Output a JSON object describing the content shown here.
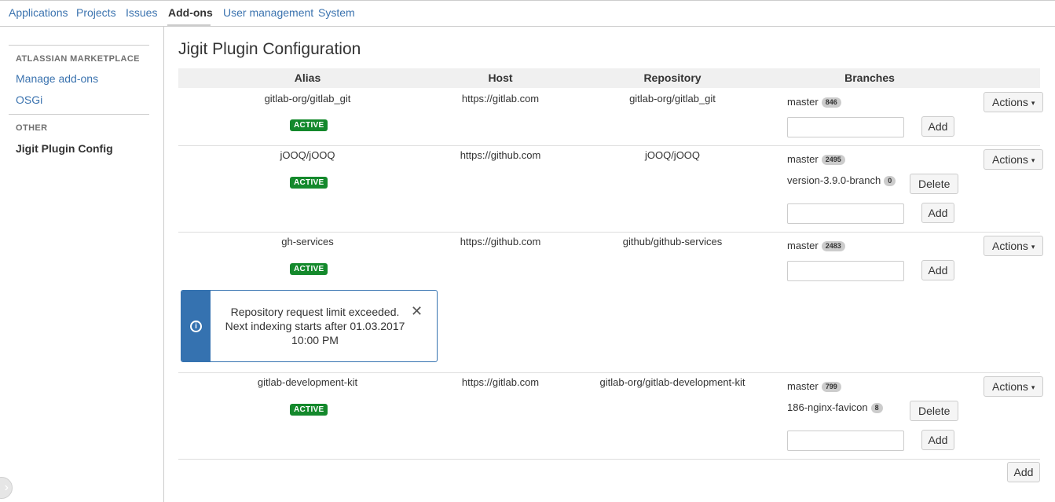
{
  "topnav": {
    "items": [
      "Applications",
      "Projects",
      "Issues",
      "Add-ons",
      "User management",
      "System"
    ],
    "active": "Add-ons"
  },
  "sidebar": {
    "section1": "ATLASSIAN MARKETPLACE",
    "link1": "Manage add-ons",
    "link2": "OSGi",
    "section2": "OTHER",
    "current": "Jigit Plugin Config"
  },
  "page": {
    "title": "Jigit Plugin Configuration"
  },
  "table": {
    "headers": {
      "alias": "Alias",
      "host": "Host",
      "repository": "Repository",
      "branches": "Branches"
    },
    "rows": [
      {
        "alias": "gitlab-org/gitlab_git",
        "host": "https://gitlab.com",
        "repository": "gitlab-org/gitlab_git",
        "status": "ACTIVE",
        "branches": [
          {
            "name": "master",
            "count": "846"
          }
        ]
      },
      {
        "alias": "jOOQ/jOOQ",
        "host": "https://github.com",
        "repository": "jOOQ/jOOQ",
        "status": "ACTIVE",
        "branches": [
          {
            "name": "master",
            "count": "2495"
          },
          {
            "name": "version-3.9.0-branch",
            "count": "0"
          }
        ]
      },
      {
        "alias": "gh-services",
        "host": "https://github.com",
        "repository": "github/github-services",
        "status": "ACTIVE",
        "branches": [
          {
            "name": "master",
            "count": "2483"
          }
        ]
      },
      {
        "alias": "gitlab-development-kit",
        "host": "https://gitlab.com",
        "repository": "gitlab-org/gitlab-development-kit",
        "status": "ACTIVE",
        "branches": [
          {
            "name": "master",
            "count": "799"
          },
          {
            "name": "186-nginx-favicon",
            "count": "8"
          }
        ]
      }
    ]
  },
  "buttons": {
    "actions": "Actions",
    "add": "Add",
    "delete": "Delete",
    "caret": "▾"
  },
  "flag": {
    "message": "Repository request limit exceeded. Next indexing starts after 01.03.2017 10:00 PM",
    "close": "✕",
    "icon": "i"
  },
  "icons": {
    "sidebar_toggle": "chevron-right-icon",
    "flag": "info-icon",
    "close": "close-icon"
  },
  "colors": {
    "link": "#3b73af",
    "active_lozenge": "#14892c",
    "flag_accent": "#3572b0"
  }
}
